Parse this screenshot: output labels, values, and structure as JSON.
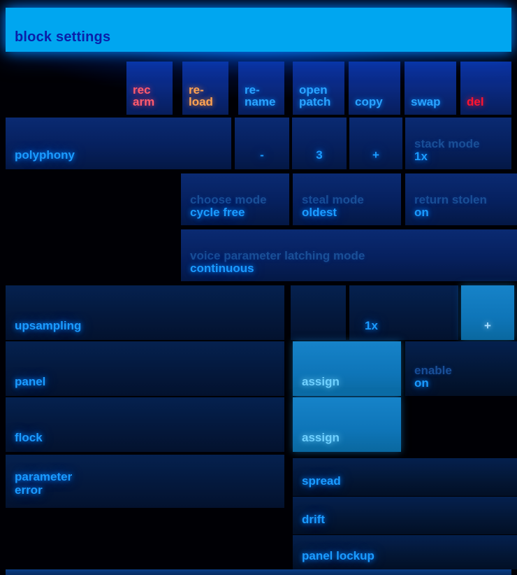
{
  "window": {
    "title": "block settings"
  },
  "actions": [
    {
      "name": "rec-arm",
      "line1": "rec",
      "line2": "arm",
      "color": "salmon"
    },
    {
      "name": "reload",
      "line1": "re-",
      "line2": "load",
      "color": "orange"
    },
    {
      "name": "rename",
      "line1": "re-",
      "line2": "name",
      "color": "blue"
    },
    {
      "name": "open-patch",
      "line1": "open",
      "line2": "patch",
      "color": "blue"
    },
    {
      "name": "copy",
      "line1": "copy",
      "line2": "",
      "color": "blue"
    },
    {
      "name": "swap",
      "line1": "swap",
      "line2": "",
      "color": "blue"
    },
    {
      "name": "del",
      "line1": "del",
      "line2": "",
      "color": "red"
    }
  ],
  "polyphony": {
    "label": "polyphony",
    "decrement": "-",
    "value": "3",
    "increment": "+",
    "stack_mode": {
      "caption": "stack mode",
      "value": "1x"
    }
  },
  "voice": {
    "choose_mode": {
      "caption": "choose mode",
      "value": "cycle free"
    },
    "steal_mode": {
      "caption": "steal mode",
      "value": "oldest"
    },
    "return_stolen": {
      "caption": "return stolen",
      "value": "on"
    },
    "latching": {
      "caption": "voice parameter latching mode",
      "value": "continuous"
    }
  },
  "upsampling": {
    "label": "upsampling",
    "value": "1x",
    "increment": "+"
  },
  "panel": {
    "label": "panel",
    "assign": "assign",
    "enable": {
      "caption": "enable",
      "value": "on"
    }
  },
  "flock": {
    "label": "flock",
    "assign": "assign"
  },
  "parameter_error": {
    "line1": "parameter",
    "line2": "error",
    "items": [
      {
        "name": "spread",
        "label": "spread"
      },
      {
        "name": "drift",
        "label": "drift"
      },
      {
        "name": "panel-lockup",
        "label": "panel lockup"
      }
    ]
  }
}
